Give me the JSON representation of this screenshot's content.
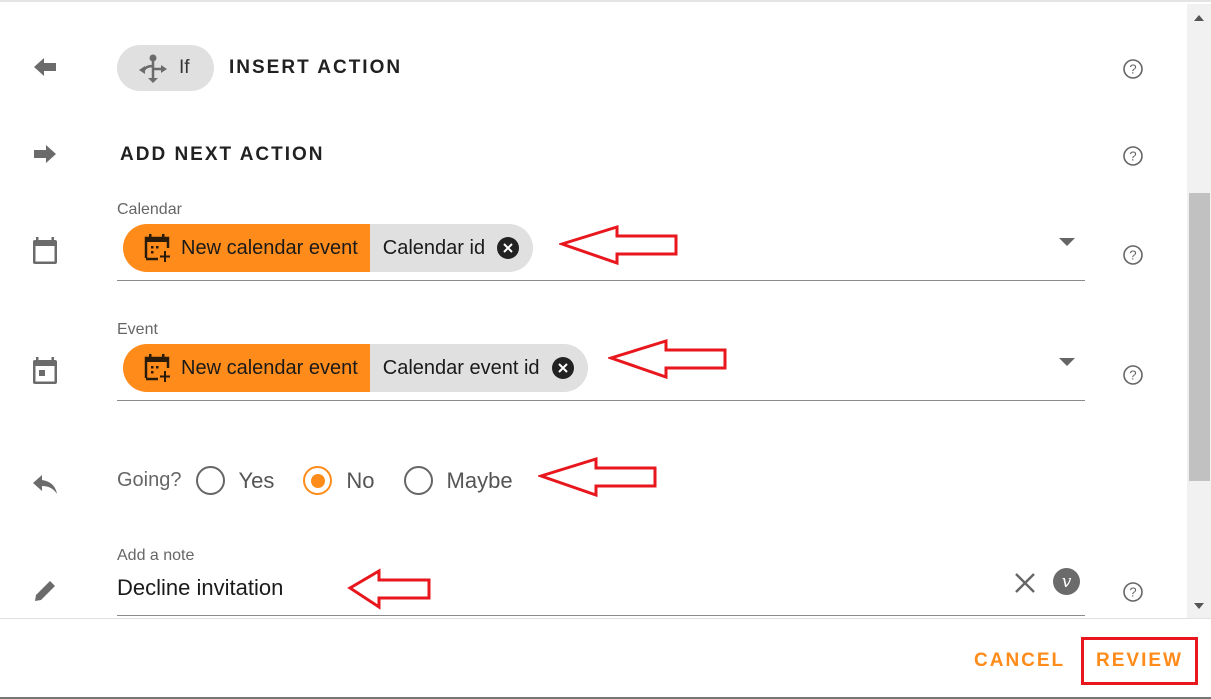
{
  "insert_action": {
    "chip_label": "If",
    "title": "INSERT ACTION"
  },
  "add_next_action": {
    "title": "ADD NEXT ACTION"
  },
  "calendar_field": {
    "label": "Calendar",
    "source_label": "New calendar event",
    "value_label": "Calendar id"
  },
  "event_field": {
    "label": "Event",
    "source_label": "New calendar event",
    "value_label": "Calendar event id"
  },
  "going_field": {
    "label": "Going?",
    "options": [
      {
        "label": "Yes",
        "checked": false
      },
      {
        "label": "No",
        "checked": true
      },
      {
        "label": "Maybe",
        "checked": false
      }
    ]
  },
  "note_field": {
    "label": "Add a note",
    "value": "Decline invitation",
    "variable_badge": "v"
  },
  "footer": {
    "cancel_label": "CANCEL",
    "review_label": "REVIEW"
  },
  "colors": {
    "accent": "#ff8c1a",
    "annotation": "#e8161d"
  }
}
